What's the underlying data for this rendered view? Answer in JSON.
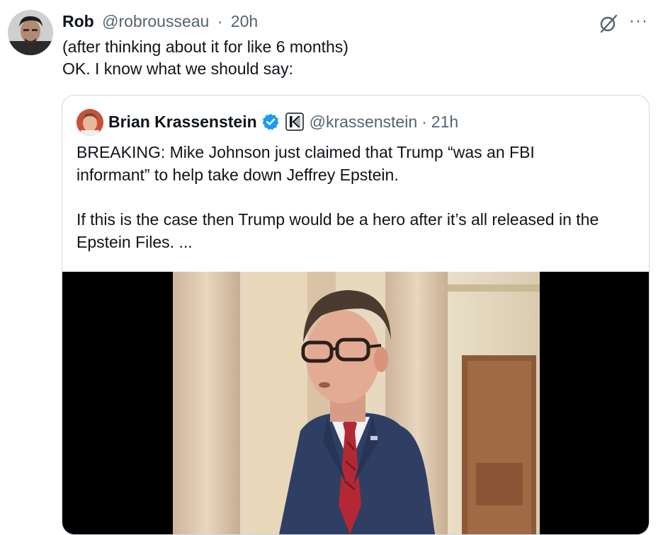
{
  "tweet": {
    "author_name": "Rob",
    "handle": "@robrousseau",
    "separator": "·",
    "time": "20h",
    "text_lines": [
      "(after thinking about it for like 6 months)",
      "OK. I know what we should say:"
    ],
    "grok_icon": "grok-slash-circle-icon",
    "more_icon": "more-horizontal-icon",
    "more_glyph": "···"
  },
  "quote": {
    "author_name": "Brian Krassenstein",
    "verified_icon": "verified-badge-icon",
    "affiliate_icon": "k-affiliate-badge-icon",
    "handle": "@krassenstein",
    "separator": "·",
    "time": "21h",
    "text_lines": [
      "BREAKING: Mike Johnson just claimed that Trump “was an FBI",
      "informant” to help take down Jeffrey Epstein."
    ],
    "text_lines_2": [
      "If this is the case then Trump would be a hero after it’s all released in the",
      "Epstein Files. ..."
    ]
  },
  "colors": {
    "text": "#0f1419",
    "secondary": "#536471",
    "border": "#cfd9de",
    "verified": "#1d9bf0"
  }
}
